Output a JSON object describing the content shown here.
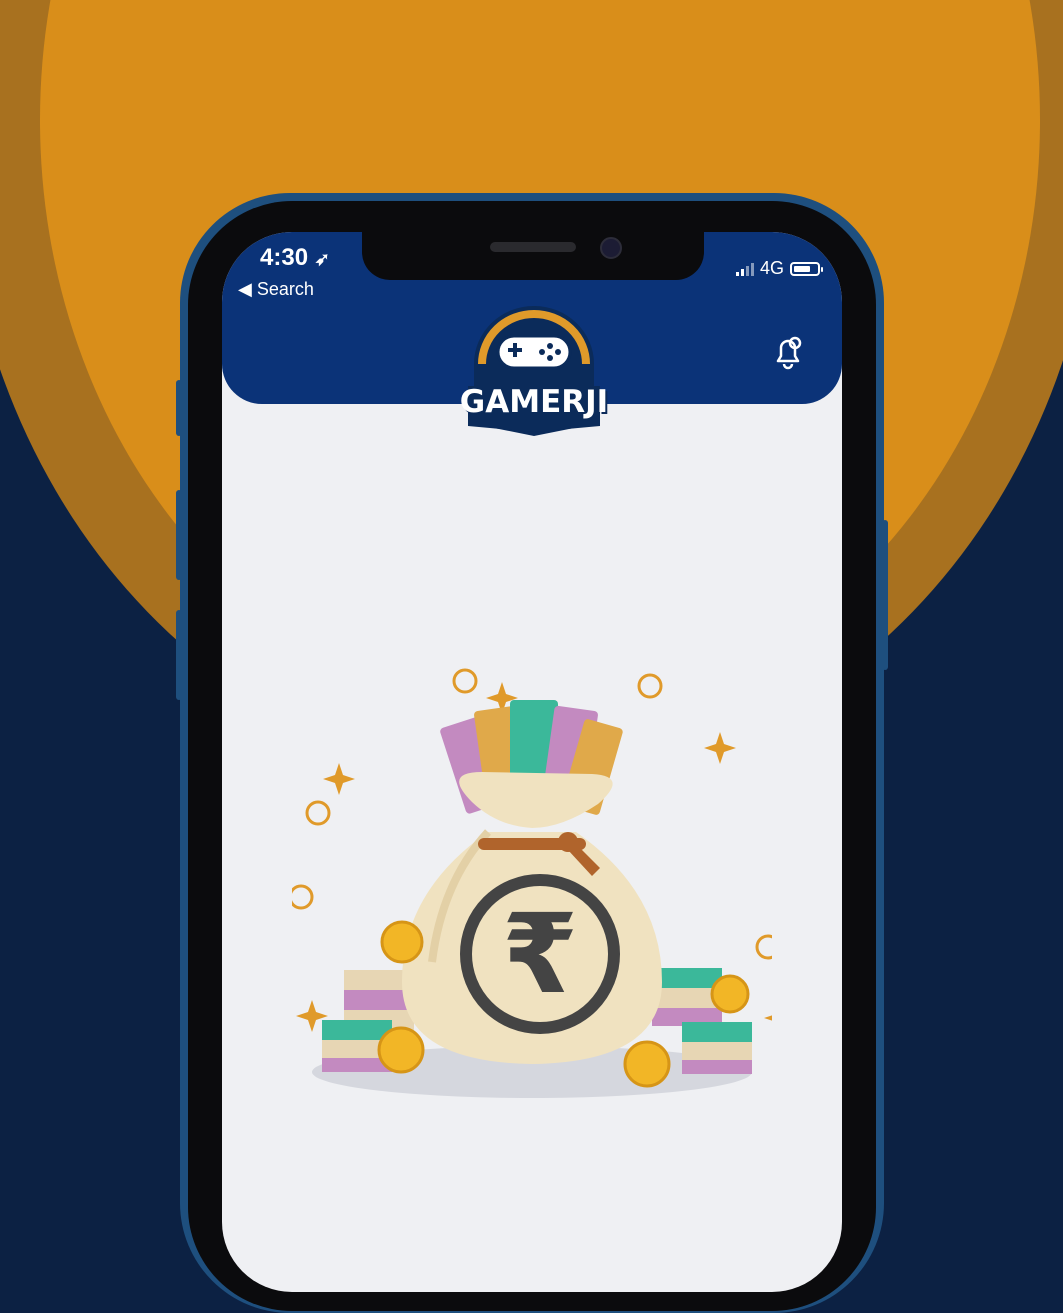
{
  "status_bar": {
    "time": "4:30",
    "back_label": "◀ Search",
    "network": "4G"
  },
  "app": {
    "logo_text": "GAMERJI",
    "bell_icon": "bell-icon"
  },
  "colors": {
    "header_bg": "#0b3378",
    "accent_gold": "#e09a2a",
    "bg_navy": "#0c2143",
    "bg_orange": "#d98e1a"
  },
  "illustration": {
    "icon": "money-bag-rupee-icon",
    "symbol": "₹"
  }
}
